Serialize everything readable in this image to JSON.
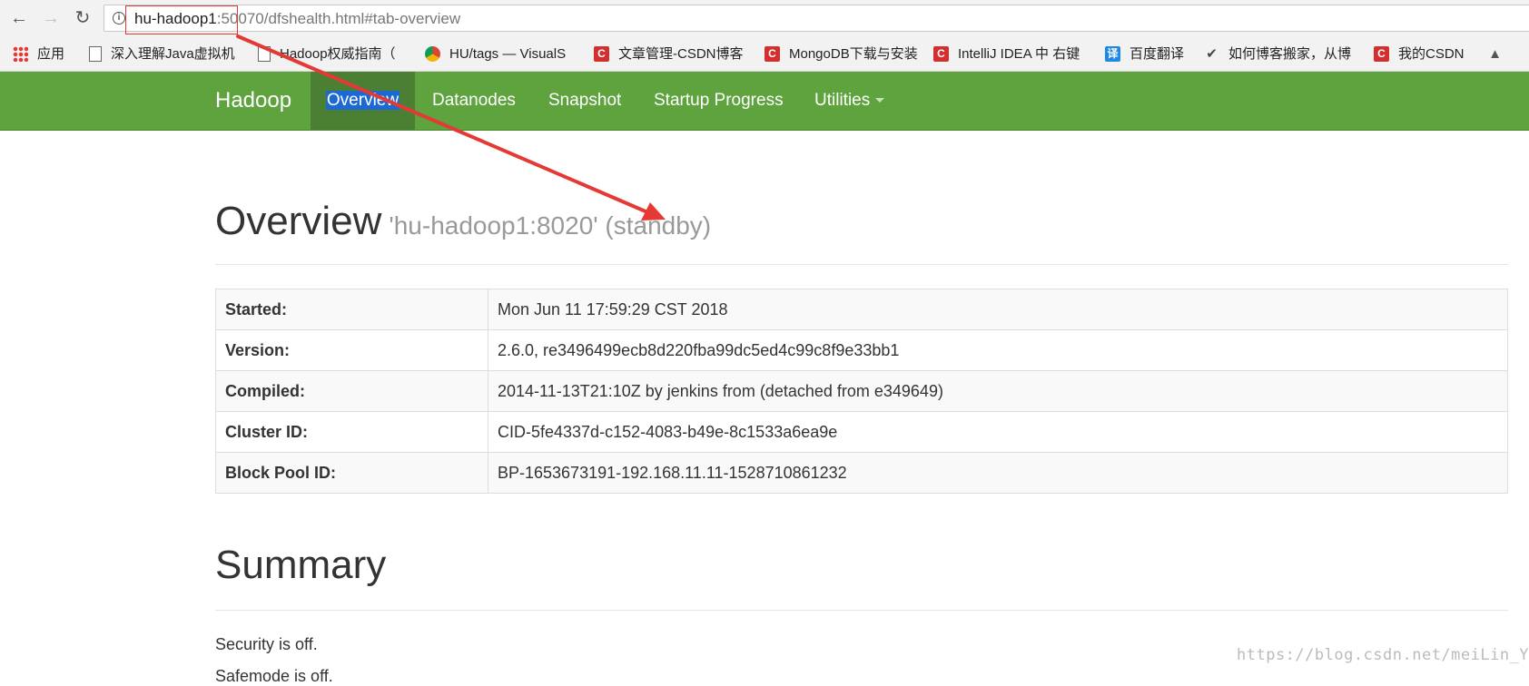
{
  "browser": {
    "url_host": "hu-hadoop1",
    "url_rest": ":50070/dfshealth.html#tab-overview",
    "bookmarks": [
      {
        "label": "应用",
        "icon": "apps-grid-icon"
      },
      {
        "label": "深入理解Java虚拟机",
        "icon": "page-icon"
      },
      {
        "label": "Hadoop权威指南（",
        "icon": "page-icon"
      },
      {
        "label": "HU/tags — VisualS",
        "icon": "chrome-icon"
      },
      {
        "label": "文章管理-CSDN博客",
        "icon": "csdn-icon"
      },
      {
        "label": "MongoDB下载与安装",
        "icon": "csdn-icon"
      },
      {
        "label": "IntelliJ IDEA 中 右键",
        "icon": "csdn-icon"
      },
      {
        "label": "百度翻译",
        "icon": "translate-icon"
      },
      {
        "label": "如何博客搬家，从博",
        "icon": "bird-icon"
      },
      {
        "label": "我的CSDN",
        "icon": "csdn-icon"
      }
    ]
  },
  "navbar": {
    "brand": "Hadoop",
    "items": [
      "Overview",
      "Datanodes",
      "Snapshot",
      "Startup Progress",
      "Utilities"
    ],
    "active": "Overview"
  },
  "overview": {
    "title": "Overview",
    "subtitle": "'hu-hadoop1:8020' (standby)",
    "rows": [
      {
        "key": "Started:",
        "value": "Mon Jun 11 17:59:29 CST 2018"
      },
      {
        "key": "Version:",
        "value": "2.6.0, re3496499ecb8d220fba99dc5ed4c99c8f9e33bb1"
      },
      {
        "key": "Compiled:",
        "value": "2014-11-13T21:10Z by jenkins from (detached from e349649)"
      },
      {
        "key": "Cluster ID:",
        "value": "CID-5fe4337d-c152-4083-b49e-8c1533a6ea9e"
      },
      {
        "key": "Block Pool ID:",
        "value": "BP-1653673191-192.168.11.11-1528710861232"
      }
    ]
  },
  "summary": {
    "title": "Summary",
    "security": "Security is off.",
    "safemode": "Safemode is off."
  },
  "watermark": "https://blog.csdn.net/meiLin_Ya",
  "colors": {
    "navbar": "#5fa33e",
    "navbar_active": "#4b7f33",
    "annotation_red": "#e53935"
  }
}
